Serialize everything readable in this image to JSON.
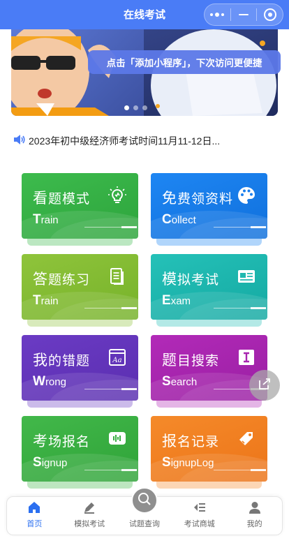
{
  "header": {
    "title": "在线考试"
  },
  "banner": {
    "hint_text": "点击「添加小程序」，下次访问更便捷",
    "slide_count": 3,
    "active_slide": 1
  },
  "notice": {
    "text": "2023年初中级经济师考试时间11月11-12日..."
  },
  "cards": [
    {
      "title_first": "看",
      "title_rest": "题模式",
      "sub_first": "T",
      "sub_rest": "rain",
      "icon": "lightbulb-icon",
      "color": "#35b247"
    },
    {
      "title_first": "免",
      "title_rest": "费领资料",
      "sub_first": "C",
      "sub_rest": "ollect",
      "icon": "palette-icon",
      "color": "#1a7fee"
    },
    {
      "title_first": "答",
      "title_rest": "题练习",
      "sub_first": "T",
      "sub_rest": "rain",
      "icon": "document-icon",
      "color": "#86bd33"
    },
    {
      "title_first": "模",
      "title_rest": "拟考试",
      "sub_first": "E",
      "sub_rest": "xam",
      "icon": "id-card-icon",
      "color": "#1fb8b0"
    },
    {
      "title_first": "我",
      "title_rest": "的错题",
      "sub_first": "W",
      "sub_rest": "rong",
      "icon": "text-box-icon",
      "color": "#6334bc"
    },
    {
      "title_first": "题",
      "title_rest": "目搜索",
      "sub_first": "S",
      "sub_rest": "earch",
      "icon": "text-cursor-icon",
      "color": "#a826b0"
    },
    {
      "title_first": "考",
      "title_rest": "场报名",
      "sub_first": "S",
      "sub_rest": "ignup",
      "icon": "waveform-icon",
      "color": "#3aae43"
    },
    {
      "title_first": "报",
      "title_rest": "名记录",
      "sub_first": "S",
      "sub_rest": "ignupLog",
      "icon": "tag-icon",
      "color": "#f18022"
    }
  ],
  "tabbar": {
    "items": [
      {
        "label": "首页",
        "icon": "home-icon",
        "active": true
      },
      {
        "label": "模拟考试",
        "icon": "pen-icon",
        "active": false
      },
      {
        "label": "试题查询",
        "icon": "search-icon",
        "active": false
      },
      {
        "label": "考试商城",
        "icon": "list-icon",
        "active": false
      },
      {
        "label": "我的",
        "icon": "user-icon",
        "active": false
      }
    ]
  },
  "colors": {
    "header_bg": "#4a7cf6",
    "tab_active": "#2b6ff0",
    "tab_inactive": "#666666"
  }
}
